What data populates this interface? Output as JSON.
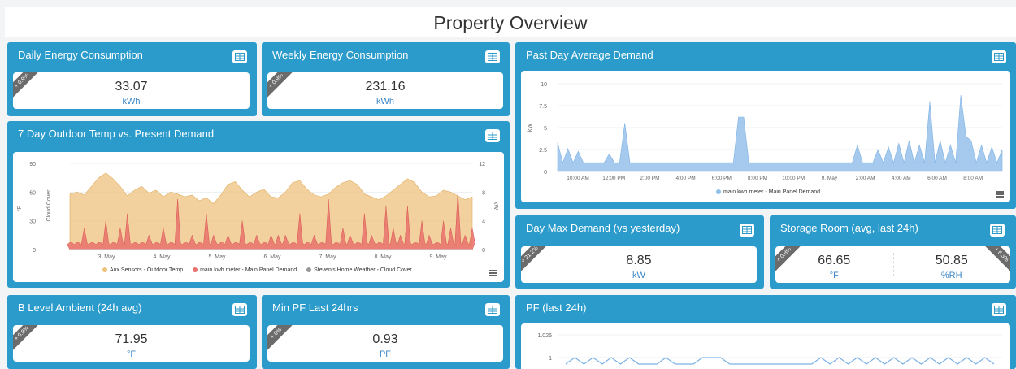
{
  "page": {
    "title": "Property Overview"
  },
  "colors": {
    "card": "#2b9bcb",
    "unit": "#3d87c6",
    "ribbon": "#6b6b6b",
    "temp": "#edc27d",
    "demand": "#e9716c",
    "cloud": "#999999",
    "avgDemand": "#8ebde8",
    "pf": "#7cb2e6"
  },
  "icons": {
    "table": "table-icon",
    "menu": "hamburger-menu-icon"
  },
  "cards": {
    "daily": {
      "title": "Daily Energy Consumption",
      "badge": "+ 0.9%",
      "value": "33.07",
      "unit": "kWh"
    },
    "weekly": {
      "title": "Weekly Energy Consumption",
      "badge": "+ 0.9%",
      "value": "231.16",
      "unit": "kWh"
    },
    "maxdemand": {
      "title": "Day Max Demand (vs yesterday)",
      "badge": "+ 21.2%",
      "value": "8.85",
      "unit": "kW"
    },
    "storage": {
      "title": "Storage Room (avg, last 24h)",
      "badge_left": "+ 0.8%",
      "badge_right": "+ 6.3%",
      "temp_value": "66.65",
      "temp_unit": "°F",
      "rh_value": "50.85",
      "rh_unit": "%RH"
    },
    "blevel": {
      "title": "B Level Ambient (24h avg)",
      "badge": "+ 0.8%",
      "value": "71.95",
      "unit": "°F"
    },
    "minpf": {
      "title": "Min PF Last 24hrs",
      "badge": "+ 0%",
      "value": "0.93",
      "unit": "PF"
    }
  },
  "chart_data": [
    {
      "id": "outdoor",
      "title": "7 Day Outdoor Temp vs. Present Demand",
      "type": "area",
      "xlabel": "",
      "ylabel_left_1": "°F",
      "ylabel_left_2": "Cloud Cover",
      "ylabel_right": "kW",
      "x_ticks": [
        "3. May",
        "4. May",
        "5. May",
        "6. May",
        "7. May",
        "8. May",
        "9. May"
      ],
      "y_ticks_left": [
        "90",
        "60",
        "30",
        "0"
      ],
      "y_ticks_right": [
        "12",
        "8",
        "4",
        "0"
      ],
      "ylim_left": [
        0,
        90
      ],
      "ylim_right": [
        0,
        12
      ],
      "legend": [
        "Aux Sensors - Outdoor Temp",
        "main kwh meter - Main Panel Demand",
        "Steven's Home Weather - Cloud Cover"
      ],
      "series": [
        {
          "name": "Aux Sensors - Outdoor Temp",
          "values": [
            58,
            60,
            57,
            66,
            75,
            80,
            74,
            66,
            56,
            62,
            66,
            59,
            62,
            55,
            60,
            58,
            55,
            57,
            51,
            54,
            48,
            57,
            68,
            71,
            62,
            55,
            60,
            63,
            55,
            54,
            60,
            70,
            72,
            63,
            57,
            55,
            58,
            65,
            70,
            72,
            68,
            58,
            55,
            52,
            56,
            62,
            68,
            74,
            70,
            60,
            55,
            56,
            62,
            60,
            56,
            52,
            55
          ]
        },
        {
          "name": "main kwh meter - Main Panel Demand",
          "values": [
            1,
            1,
            3,
            1,
            1,
            4,
            1,
            3,
            5,
            1,
            1,
            2,
            1,
            3,
            1,
            7,
            1,
            2,
            1,
            5,
            2,
            1,
            2,
            1,
            4,
            1,
            2,
            1,
            2,
            2,
            2,
            1,
            5,
            1,
            2,
            1,
            7,
            1,
            3,
            2,
            1,
            5,
            2,
            1,
            6,
            3,
            2,
            6,
            1,
            4,
            2,
            1,
            4,
            3,
            8,
            2,
            3
          ]
        }
      ]
    },
    {
      "id": "avgdemand",
      "title": "Past Day Average Demand",
      "type": "area",
      "xlabel": "",
      "ylabel": "kW",
      "x_ticks": [
        "10:00 AM",
        "12:00 PM",
        "2:00 PM",
        "4:00 PM",
        "6:00 PM",
        "8:00 PM",
        "10:00 PM",
        "9. May",
        "2:00 AM",
        "4:00 AM",
        "6:00 AM",
        "8:00 AM"
      ],
      "y_ticks": [
        "10",
        "7.5",
        "5",
        "2.5",
        "0"
      ],
      "ylim": [
        0,
        10
      ],
      "legend": [
        "main kwh meter - Main Panel Demand"
      ],
      "series": [
        {
          "name": "main kwh meter - Main Panel Demand",
          "values": [
            3.3,
            1,
            2.6,
            1,
            2.3,
            1,
            1,
            1,
            1,
            1,
            2,
            1,
            1,
            5.5,
            1,
            1,
            1,
            1,
            1,
            1,
            1,
            1,
            1,
            1,
            1,
            1,
            1,
            1,
            1,
            1,
            1,
            1,
            1,
            1,
            1,
            6.2,
            6.2,
            1,
            1,
            1,
            1,
            1,
            1,
            1,
            1,
            1,
            1,
            1,
            1,
            1,
            1,
            1,
            1,
            1,
            1,
            1,
            1,
            1,
            3,
            1,
            1,
            1,
            2.5,
            1,
            2.8,
            1,
            3.2,
            1,
            3.5,
            1,
            3,
            1,
            8,
            1,
            3.5,
            1,
            3,
            1,
            8.7,
            4,
            3.5,
            1,
            3,
            1,
            2.8,
            1,
            2.5
          ]
        }
      ]
    },
    {
      "id": "pf",
      "title": "PF (last 24h)",
      "type": "line",
      "y_ticks": [
        "1.025",
        "1"
      ],
      "series": [
        {
          "name": "PF",
          "values": [
            0.99,
            1,
            0.99,
            1,
            0.99,
            1,
            0.99,
            1,
            0.99,
            0.99,
            0.99,
            1,
            0.99,
            0.99,
            0.99,
            1,
            1,
            1,
            0.99,
            0.99,
            0.99,
            0.99,
            0.99,
            0.99,
            0.99,
            0.99,
            0.99,
            0.99,
            1,
            0.99,
            1,
            0.99,
            1,
            0.99,
            1,
            0.99,
            1,
            0.99,
            1,
            0.99,
            1,
            0.99,
            1,
            0.99,
            1,
            0.99,
            1,
            0.99
          ]
        }
      ]
    }
  ]
}
